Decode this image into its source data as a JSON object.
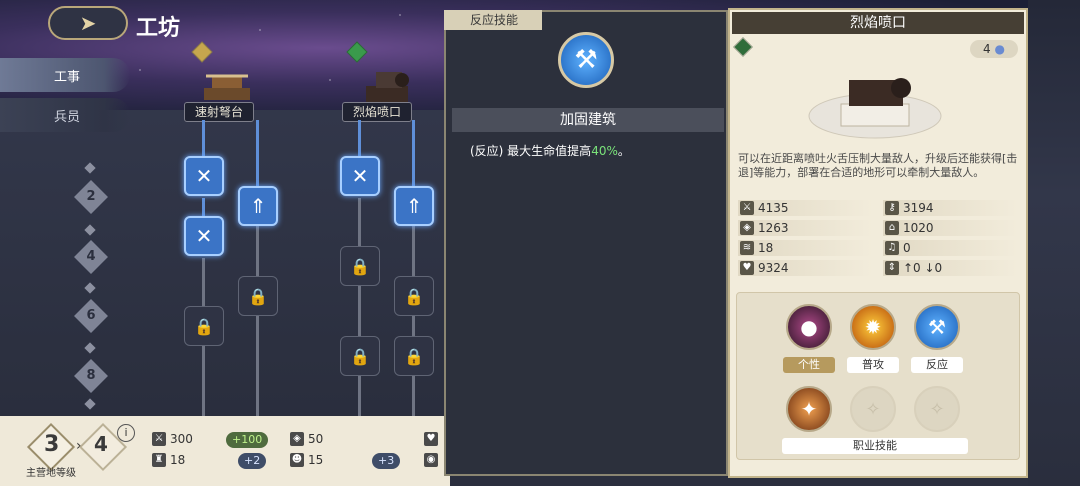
{
  "header": {
    "back_icon": "arrow-back-icon",
    "title": "工坊"
  },
  "side_tabs": [
    {
      "label": "工事",
      "active": true
    },
    {
      "label": "兵员",
      "active": false
    }
  ],
  "towers": [
    {
      "label": "速射弩台"
    },
    {
      "label": "烈焰喷口"
    }
  ],
  "levels": [
    "2",
    "4",
    "6",
    "8"
  ],
  "bottom": {
    "current_level": "3",
    "next_level": "4",
    "level_caption": "主营地等级",
    "stats": [
      {
        "value": "300",
        "bonus": "+100"
      },
      {
        "value": "50"
      },
      {
        "value": "18",
        "bonus": "+2"
      },
      {
        "value": "15",
        "bonus": "+3"
      }
    ]
  },
  "popup": {
    "tag": "反应技能",
    "skill_name": "加固建筑",
    "desc_prefix": "(反应) 最大生命值提高",
    "desc_value": "40%",
    "desc_suffix": "。"
  },
  "detail": {
    "title": "烈焰喷口",
    "cost": "4",
    "description": "可以在近距离喷吐火舌压制大量敌人，升级后还能获得[击退]等能力，部署在合适的地形可以牵制大量敌人。",
    "stats": [
      {
        "icon": "sword-icon",
        "value": "4135"
      },
      {
        "icon": "key-icon",
        "value": "3194"
      },
      {
        "icon": "shield-icon",
        "value": "1263"
      },
      {
        "icon": "boot-icon",
        "value": "1020"
      },
      {
        "icon": "wing-icon",
        "value": "18"
      },
      {
        "icon": "bell-icon",
        "value": "0"
      },
      {
        "icon": "heart-icon",
        "value": "9324"
      },
      {
        "icon": "arrows-icon",
        "value": "↑0 ↓0"
      }
    ],
    "skills": [
      {
        "label": "个性",
        "selected": true
      },
      {
        "label": "普攻",
        "selected": false
      },
      {
        "label": "反应",
        "selected": false
      }
    ],
    "job_skill_label": "职业技能"
  },
  "colors": {
    "accent_blue": "#3b74c6",
    "panel_cream": "#f2ecdb",
    "popup_dark": "#2c303c",
    "green_text": "#7ae37a"
  }
}
